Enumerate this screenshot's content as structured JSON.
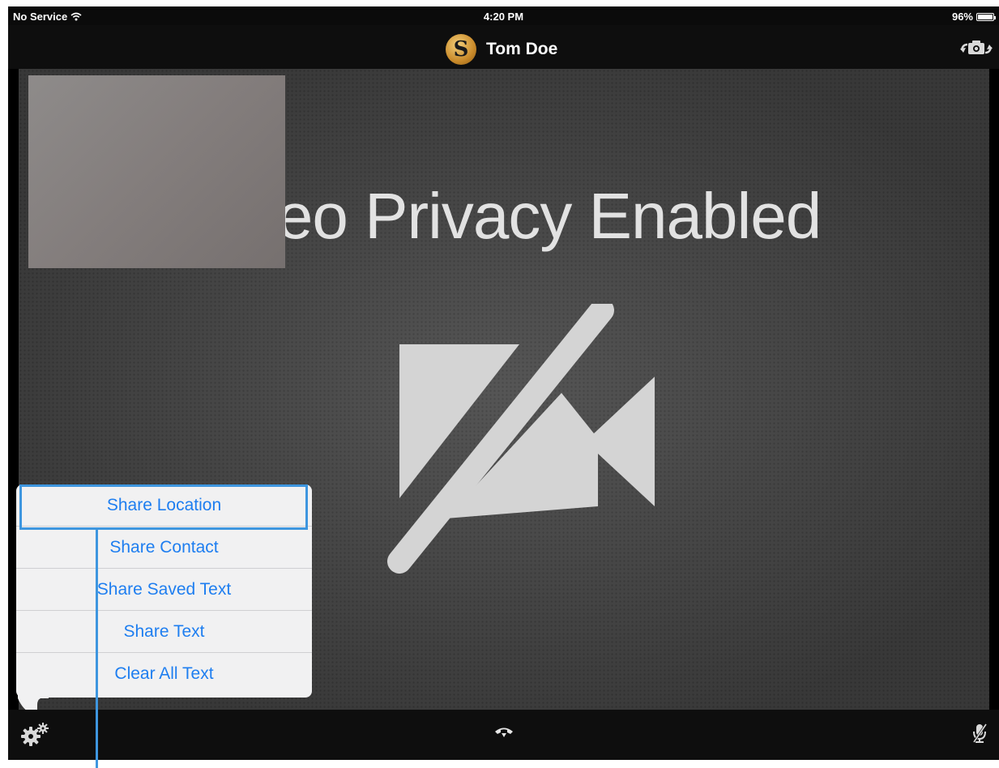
{
  "status_bar": {
    "carrier": "No Service",
    "time": "4:20 PM",
    "battery": "96%",
    "battery_level": 0.96
  },
  "header": {
    "logo_letter": "S",
    "contact_name": "Tom Doe",
    "switch_camera_icon": "switch-camera-icon"
  },
  "video": {
    "status_text": "Video Privacy Enabled",
    "icon": "video-off-icon"
  },
  "share_menu": {
    "items": [
      {
        "label": "Share Location"
      },
      {
        "label": "Share Contact"
      },
      {
        "label": "Share Saved Text"
      },
      {
        "label": "Share Text"
      },
      {
        "label": "Clear All Text"
      }
    ]
  },
  "toolbar": {
    "settings_icon": "gear-icon",
    "hangup_icon": "hang-up-icon",
    "mute_icon": "microphone-mute-icon"
  },
  "colors": {
    "menu_text": "#1e7ef0",
    "callout": "#3e96df",
    "app_logo": "#c98a2a"
  }
}
